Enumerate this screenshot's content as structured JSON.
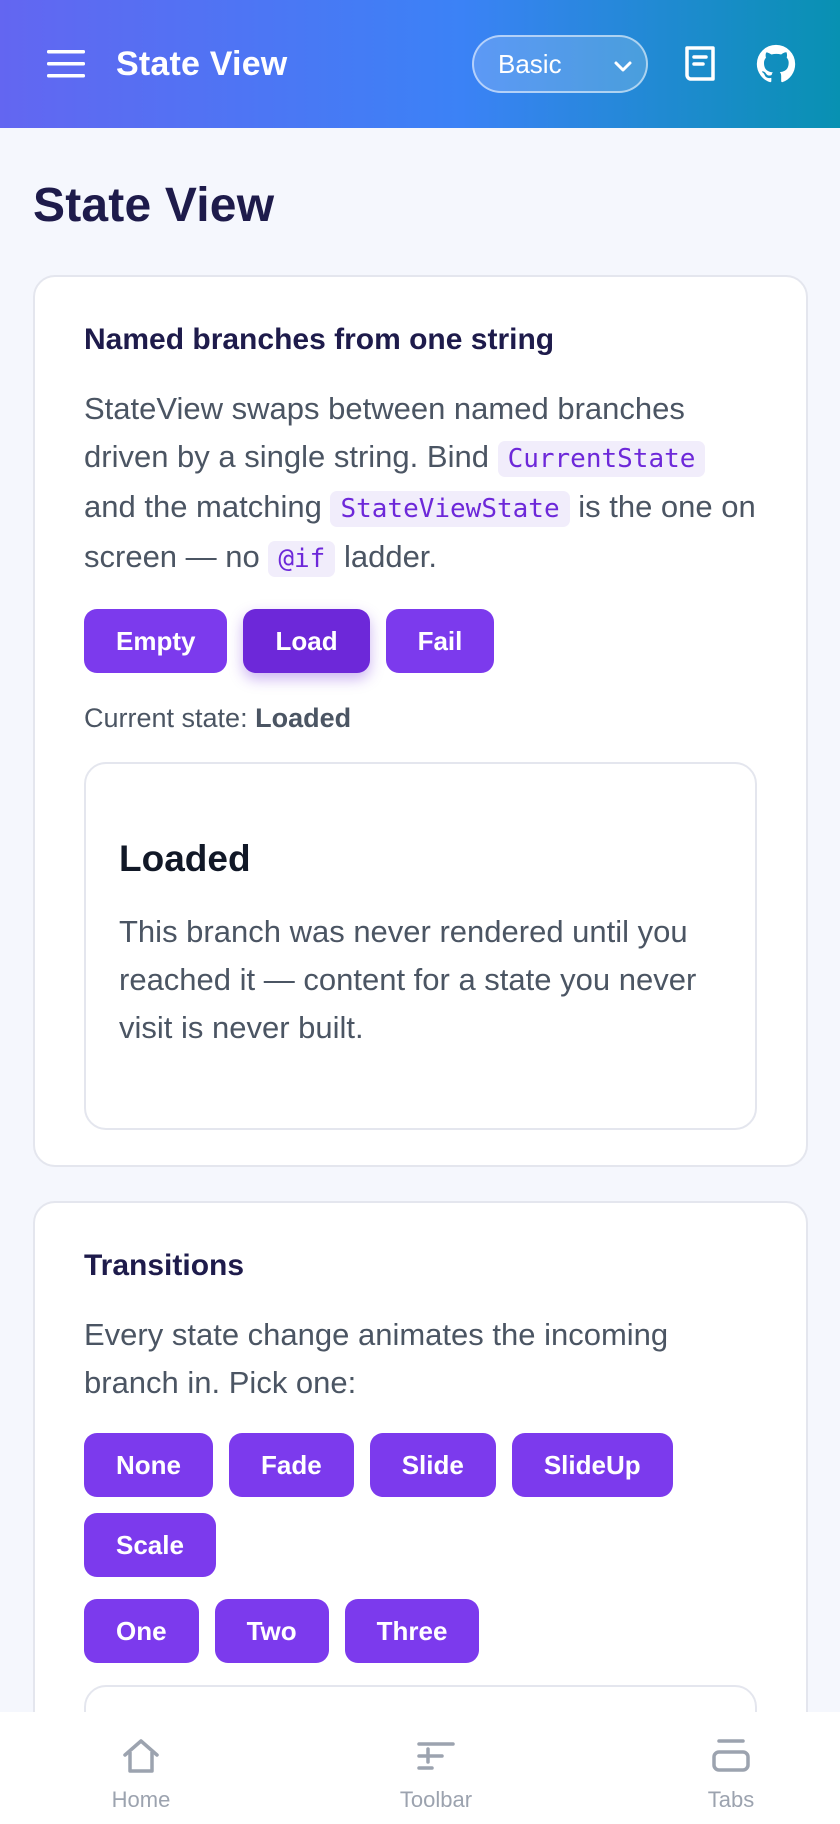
{
  "header": {
    "title": "State View",
    "variant_selected": "Basic",
    "icons": [
      "menu-icon",
      "docs-icon",
      "github-icon"
    ]
  },
  "page": {
    "title": "State View"
  },
  "card1": {
    "title": "Named branches from one string",
    "desc_1": "StateView swaps between named branches driven by a single string. Bind ",
    "code_1": "CurrentState",
    "desc_2": " and the matching ",
    "code_2": "StateViewState",
    "desc_3": " is the one on screen — no ",
    "code_3": "@if",
    "desc_4": " ladder.",
    "buttons": [
      "Empty",
      "Load",
      "Fail"
    ],
    "active_button": "Load",
    "state_prefix": "Current state: ",
    "state_value": "Loaded",
    "panel_title": "Loaded",
    "panel_text": "This branch was never rendered until you reached it — content for a state you never visit is never built."
  },
  "card2": {
    "title": "Transitions",
    "desc": "Every state change animates the incoming branch in. Pick one:",
    "transition_buttons": [
      "None",
      "Fade",
      "Slide",
      "SlideUp",
      "Scale"
    ],
    "state_buttons": [
      "One",
      "Two",
      "Three"
    ]
  },
  "tabbar": {
    "tabs": [
      {
        "label": "Home",
        "icon": "home-icon"
      },
      {
        "label": "Toolbar",
        "icon": "toolbar-icon"
      },
      {
        "label": "Tabs",
        "icon": "tabs-icon"
      }
    ]
  },
  "colors": {
    "accent": "#7c3aed",
    "accent_active": "#6d28d9",
    "header_start": "#6366f1",
    "header_end": "#0891b2"
  }
}
